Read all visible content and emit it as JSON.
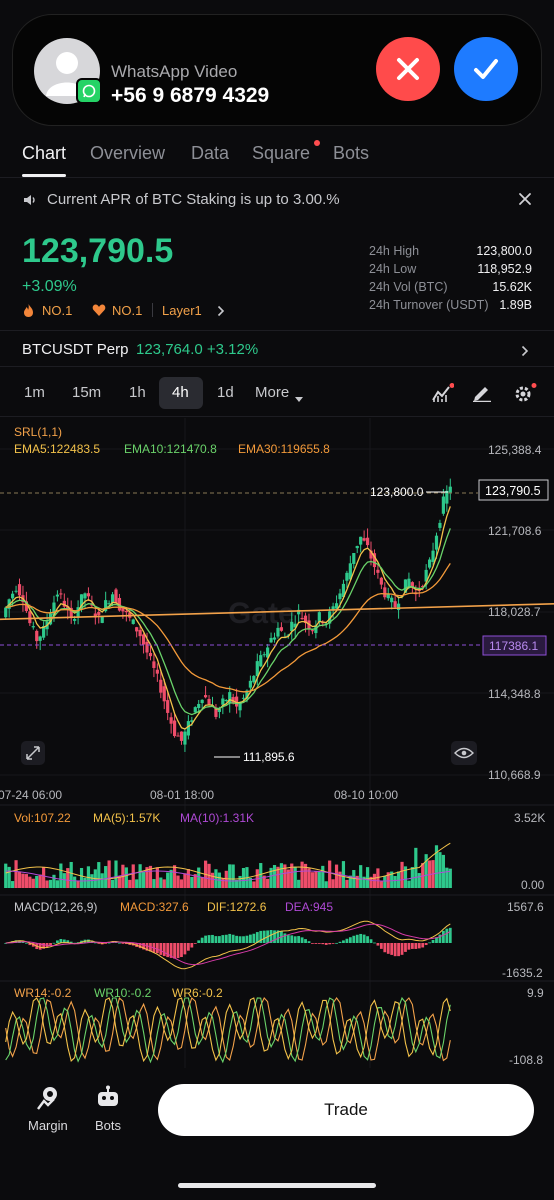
{
  "call": {
    "title": "WhatsApp Video",
    "number": "+56 9 6879 4329",
    "avatar_icon": "person-icon",
    "decline_icon": "close-icon",
    "accept_icon": "check-icon",
    "decline_color": "#ff4b4b",
    "accept_color": "#1e7bff"
  },
  "tabs": [
    {
      "label": "Chart",
      "active": true
    },
    {
      "label": "Overview"
    },
    {
      "label": "Data"
    },
    {
      "label": "Square",
      "badge": true
    },
    {
      "label": "Bots"
    }
  ],
  "notice": {
    "text": "Current APR of BTC Staking is up to 3.00.%"
  },
  "ticker": {
    "price": "123,790.5",
    "change": "+3.09%",
    "tags": [
      "NO.1",
      "NO.1",
      "Layer1"
    ],
    "stats": [
      {
        "label": "24h High",
        "value": "123,800.0"
      },
      {
        "label": "24h Low",
        "value": "118,952.9"
      },
      {
        "label": "24h Vol (BTC)",
        "value": "15.62K"
      },
      {
        "label": "24h Turnover (USDT)",
        "value": "1.89B"
      }
    ]
  },
  "perp": {
    "name": "BTCUSDT Perp",
    "price_change": "123,764.0 +3.12%"
  },
  "timeframes": [
    "1m",
    "15m",
    "1h",
    "4h",
    "1d",
    "More"
  ],
  "active_timeframe": "4h",
  "chart": {
    "indicator_title": "SRL(1,1)",
    "ema5": "EMA5:122483.5",
    "ema10": "EMA10:121470.8",
    "ema30": "EMA30:119655.8",
    "y_ticks": [
      "125,388.4",
      "121,708.6",
      "118,028.7",
      "114,348.8",
      "110,668.9"
    ],
    "x_ticks": [
      "07-24 06:00",
      "08-01 18:00",
      "08-10 10:00"
    ],
    "high_label": "123,800.0",
    "low_label": "111,895.6",
    "last_price_tag": "123,790.5",
    "srl_tag": "117386.1",
    "watermark": "Gate",
    "vol": {
      "label": "Vol:107.22",
      "ma5": "MA(5):1.57K",
      "ma10": "MA(10):1.31K",
      "top": "3.52K",
      "bottom": "0.00"
    },
    "macd": {
      "label": "MACD(12,26,9)",
      "macd": "MACD:327.6",
      "dif": "DIF:1272.6",
      "dea": "DEA:945",
      "top": "1567.6",
      "bottom": "-1635.2"
    },
    "wr": {
      "wr14": "WR14:-0.2",
      "wr10": "WR10:-0.2",
      "wr6": "WR6:-0.2",
      "top": "9.9",
      "bottom": "-108.8"
    }
  },
  "chart_data": {
    "type": "candlestick",
    "y_range": [
      110668.9,
      125388.4
    ],
    "series": [
      {
        "name": "EMA5",
        "value": 122483.5
      },
      {
        "name": "EMA10",
        "value": 121470.8
      },
      {
        "name": "EMA30",
        "value": 119655.8
      }
    ],
    "close_path": [
      117800,
      118600,
      119200,
      118700,
      117500,
      116800,
      117200,
      118100,
      118900,
      118400,
      117600,
      118300,
      118900,
      118200,
      117700,
      118400,
      118900,
      118300,
      117900,
      117500,
      117000,
      116200,
      115400,
      114600,
      113500,
      112600,
      112200,
      112900,
      113700,
      114300,
      114000,
      113400,
      113900,
      114300,
      113700,
      114100,
      114800,
      115600,
      116200,
      116800,
      117300,
      116900,
      117500,
      118000,
      117600,
      117300,
      117800,
      117600,
      118200,
      118900,
      119700,
      120800,
      121400,
      120900,
      120100,
      119200,
      118600,
      118300,
      119000,
      119500,
      118800,
      119400,
      120200,
      121600,
      123000,
      123790.5
    ],
    "high": 123800.0,
    "low": 111895.6
  },
  "bottom_nav": {
    "margin_label": "Margin",
    "bots_label": "Bots",
    "trade_label": "Trade"
  }
}
